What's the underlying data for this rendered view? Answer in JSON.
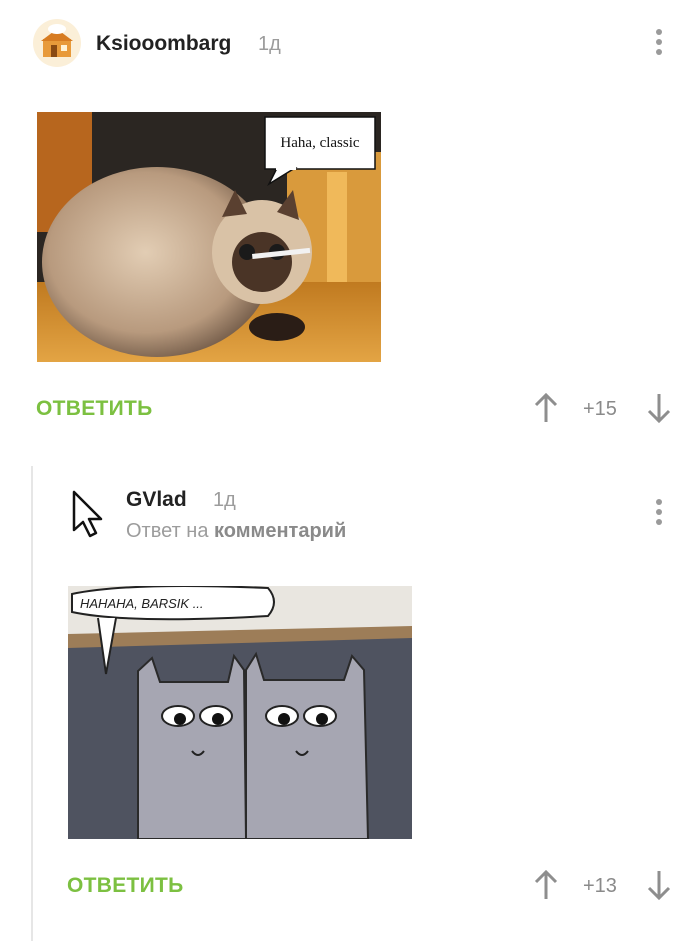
{
  "comment1": {
    "author": "Ksiooombarg",
    "time": "1д",
    "image_caption": "Haha, classic",
    "reply_label": "ОТВЕТИТЬ",
    "score": "+15"
  },
  "comment2": {
    "author": "GVlad",
    "time": "1д",
    "reply_to_prefix": "Ответ на",
    "reply_to_link": "комментарий",
    "image_caption": "HAHAHA, BARSIK ...",
    "reply_label": "ОТВЕТИТЬ",
    "score": "+13"
  },
  "colors": {
    "reply_green": "#7cc041",
    "muted_gray": "#9c9c9c"
  },
  "icons": [
    "avatar-house-icon",
    "cursor-avatar-icon",
    "more-dots-icon",
    "arrow-up-icon",
    "arrow-down-icon"
  ]
}
